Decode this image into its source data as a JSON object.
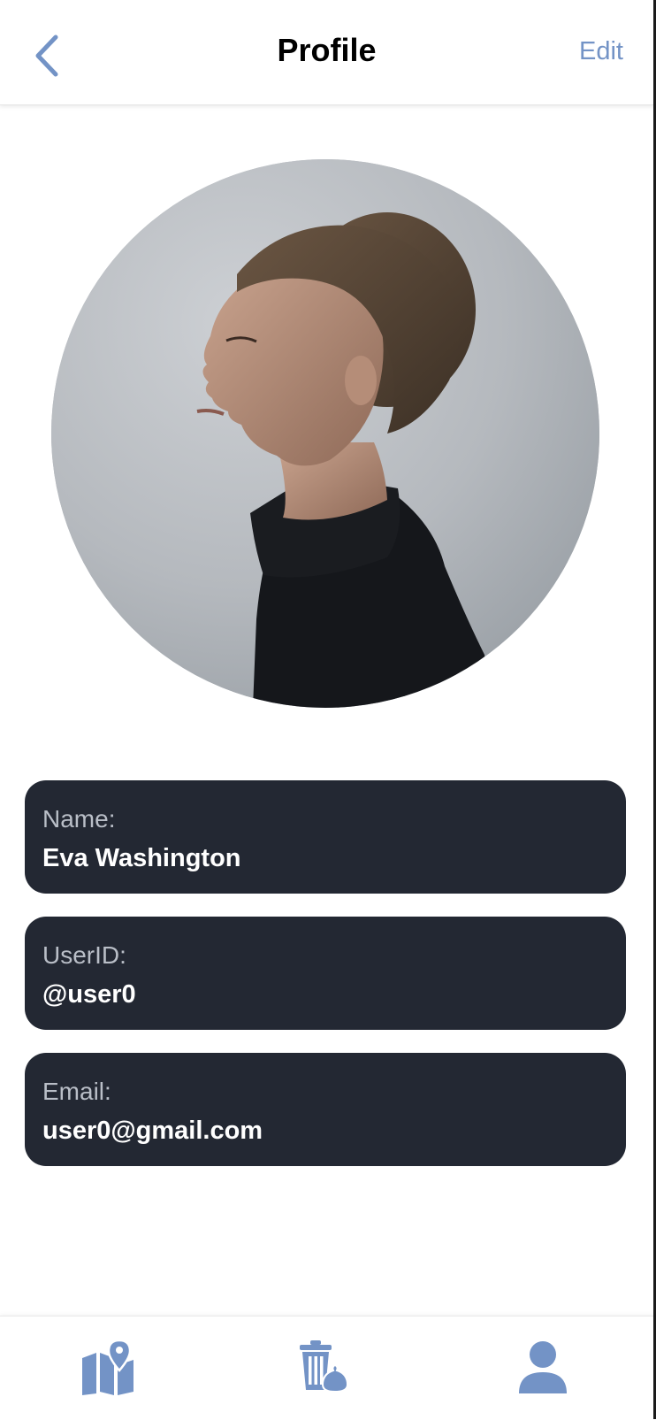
{
  "header": {
    "title": "Profile",
    "edit_label": "Edit",
    "back_icon": "chevron-left-icon"
  },
  "avatar": {
    "description_icon": "profile-photo"
  },
  "fields": [
    {
      "label": "Name:",
      "value": "Eva Washington"
    },
    {
      "label": "UserID:",
      "value": "@user0"
    },
    {
      "label": "Email:",
      "value": "user0@gmail.com"
    }
  ],
  "bottom_nav": {
    "items": [
      {
        "icon": "map-pin-icon"
      },
      {
        "icon": "trash-bag-icon"
      },
      {
        "icon": "user-icon"
      }
    ]
  },
  "colors": {
    "accent": "#7393c6",
    "card_bg": "#232833",
    "card_label": "#b9bec7",
    "text_primary": "#000000"
  }
}
